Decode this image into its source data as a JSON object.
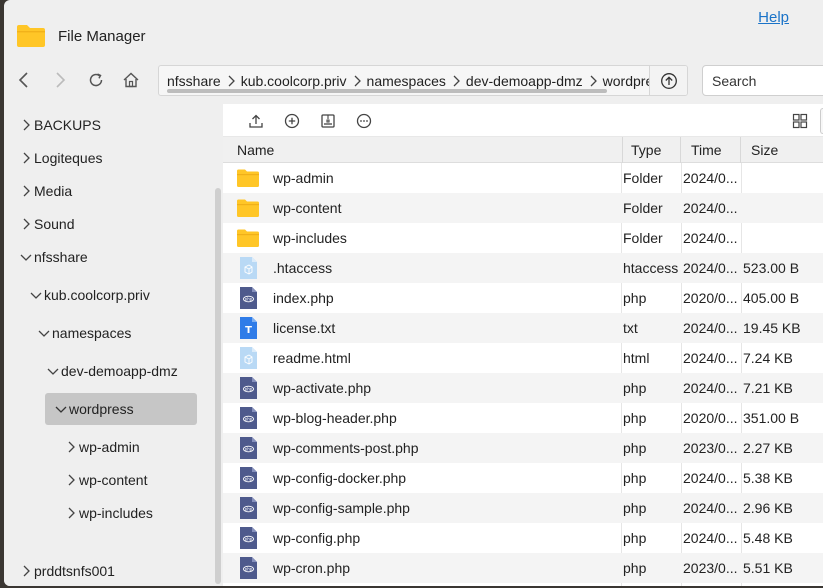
{
  "app": {
    "title": "File Manager",
    "help_label": "Help"
  },
  "toolbar": {
    "breadcrumbs": [
      "nfsshare",
      "kub.coolcorp.priv",
      "namespaces",
      "dev-demoapp-dmz",
      "wordpress"
    ],
    "search_placeholder": "Search"
  },
  "sidebar": {
    "items": [
      {
        "label": "BACKUPS",
        "expanded": false
      },
      {
        "label": "Logiteques",
        "expanded": false
      },
      {
        "label": "Media",
        "expanded": false
      },
      {
        "label": "Sound",
        "expanded": false
      },
      {
        "label": "nfsshare",
        "expanded": true
      },
      {
        "label": "kub.coolcorp.priv",
        "expanded": true
      },
      {
        "label": "namespaces",
        "expanded": true
      },
      {
        "label": "dev-demoapp-dmz",
        "expanded": true
      },
      {
        "label": "wordpress",
        "expanded": true,
        "selected": true
      },
      {
        "label": "wp-admin",
        "expanded": false
      },
      {
        "label": "wp-content",
        "expanded": false
      },
      {
        "label": "wp-includes",
        "expanded": false
      },
      {
        "label": "prddtsnfs001",
        "expanded": false
      }
    ]
  },
  "table": {
    "columns": [
      "Name",
      "Type",
      "Time",
      "Size"
    ],
    "rows": [
      {
        "icon": "folder-icon",
        "name": "wp-admin",
        "type": "Folder",
        "time": "2024/0...",
        "size": ""
      },
      {
        "icon": "folder-icon",
        "name": "wp-content",
        "type": "Folder",
        "time": "2024/0...",
        "size": ""
      },
      {
        "icon": "folder-icon",
        "name": "wp-includes",
        "type": "Folder",
        "time": "2024/0...",
        "size": ""
      },
      {
        "icon": "generic-file-icon",
        "name": ".htaccess",
        "type": "htaccess",
        "time": "2024/0...",
        "size": "523.00 B"
      },
      {
        "icon": "php-file-icon",
        "name": "index.php",
        "type": "php",
        "time": "2020/0...",
        "size": "405.00 B"
      },
      {
        "icon": "text-file-icon",
        "name": "license.txt",
        "type": "txt",
        "time": "2024/0...",
        "size": "19.45 KB"
      },
      {
        "icon": "generic-file-icon",
        "name": "readme.html",
        "type": "html",
        "time": "2024/0...",
        "size": "7.24 KB"
      },
      {
        "icon": "php-file-icon",
        "name": "wp-activate.php",
        "type": "php",
        "time": "2024/0...",
        "size": "7.21 KB"
      },
      {
        "icon": "php-file-icon",
        "name": "wp-blog-header.php",
        "type": "php",
        "time": "2020/0...",
        "size": "351.00 B"
      },
      {
        "icon": "php-file-icon",
        "name": "wp-comments-post.php",
        "type": "php",
        "time": "2023/0...",
        "size": "2.27 KB"
      },
      {
        "icon": "php-file-icon",
        "name": "wp-config-docker.php",
        "type": "php",
        "time": "2024/0...",
        "size": "5.38 KB"
      },
      {
        "icon": "php-file-icon",
        "name": "wp-config-sample.php",
        "type": "php",
        "time": "2024/0...",
        "size": "2.96 KB"
      },
      {
        "icon": "php-file-icon",
        "name": "wp-config.php",
        "type": "php",
        "time": "2024/0...",
        "size": "5.48 KB"
      },
      {
        "icon": "php-file-icon",
        "name": "wp-cron.php",
        "type": "php",
        "time": "2023/0...",
        "size": "5.51 KB"
      }
    ]
  },
  "colors": {
    "folder": "#ffc627",
    "php_icon": "#4e5a8c",
    "txt_icon": "#2f7ce8",
    "generic_icon": "#b9d9f5",
    "accent_link": "#1a73c8",
    "selected_item": "#c6c6c6"
  }
}
